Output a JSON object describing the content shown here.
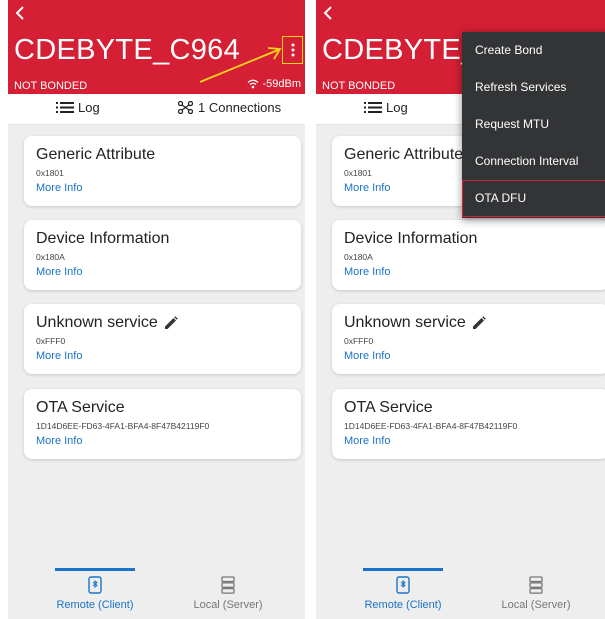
{
  "header": {
    "device_name": "CDEBYTE_C964",
    "device_name_truncated": "CDEBYTE_",
    "bond_status": "NOT BONDED",
    "rssi": "-59dBm"
  },
  "subbar": {
    "log_label": "Log",
    "connections_label": "1 Connections"
  },
  "services": [
    {
      "name": "Generic Attribute",
      "uuid": "0x1801",
      "link": "More Info"
    },
    {
      "name": "Device Information",
      "uuid": "0x180A",
      "link": "More Info"
    },
    {
      "name": "Unknown service",
      "uuid": "0xFFF0",
      "link": "More Info"
    },
    {
      "name": "OTA Service",
      "uuid": "1D14D6EE-FD63-4FA1-BFA4-8F47B42119F0",
      "link": "More Info"
    }
  ],
  "bottom_nav": {
    "remote_label": "Remote (Client)",
    "local_label": "Local (Server)"
  },
  "menu": {
    "items": [
      "Create Bond",
      "Refresh Services",
      "Request MTU",
      "Connection Interval",
      "OTA DFU"
    ]
  },
  "colors": {
    "header": "#d41f34",
    "accent": "#1a73c8",
    "highlight": "#ffd21e",
    "menu_bg": "#333436"
  }
}
